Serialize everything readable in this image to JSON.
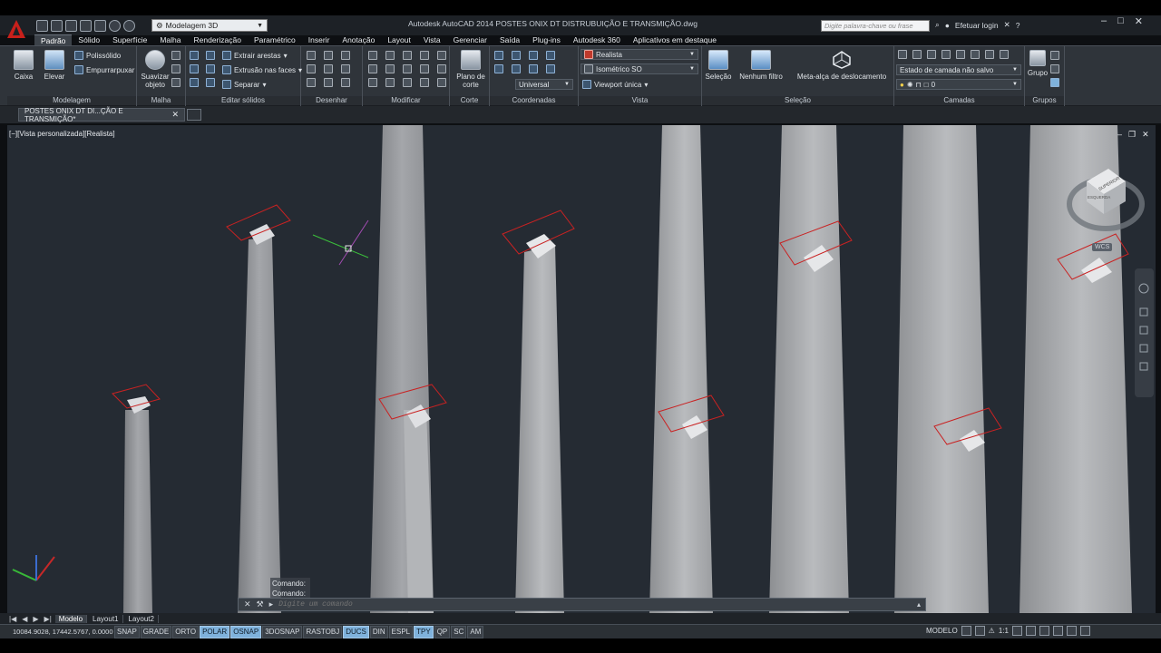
{
  "window": {
    "title": "Autodesk AutoCAD 2014     POSTES ONIX DT DISTRUBUIÇÃO E TRANSMIÇÃO.dwg",
    "workspace": "Modelagem 3D",
    "search_placeholder": "Digite palavra-chave ou frase",
    "login_label": "Efetuar login"
  },
  "ribbon": {
    "tabs": [
      "Padrão",
      "Sólido",
      "Superfície",
      "Malha",
      "Renderização",
      "Paramétrico",
      "Inserir",
      "Anotação",
      "Layout",
      "Vista",
      "Gerenciar",
      "Saída",
      "Plug-ins",
      "Autodesk 360",
      "Aplicativos em destaque"
    ],
    "active_tab": "Padrão",
    "modelagem": {
      "label": "Modelagem",
      "caixa": "Caixa",
      "elevar": "Elevar",
      "polissolido": "Polissólido",
      "empurrarpuxar": "Empurrarpuxar"
    },
    "malha": {
      "label": "Malha",
      "suavizar": "Suavizar objeto"
    },
    "editar_solidos": {
      "label": "Editar sólidos",
      "extrair": "Extrair arestas",
      "extrusao": "Extrusão nas faces",
      "separar": "Separar"
    },
    "desenhar": {
      "label": "Desenhar"
    },
    "modificar": {
      "label": "Modificar"
    },
    "corte": {
      "label": "Corte",
      "plano": "Plano de corte"
    },
    "coordenadas": {
      "label": "Coordenadas",
      "universal": "Universal"
    },
    "vista": {
      "label": "Vista",
      "style": "Realista",
      "view": "Isométrico SO",
      "viewport": "Viewport única"
    },
    "selecao": {
      "label": "Seleção",
      "selecao": "Seleção",
      "filtro": "Nenhum filtro",
      "meta": "Meta-alça de deslocamento"
    },
    "camadas": {
      "label": "Camadas",
      "estado": "Estado de camada não salvo",
      "layer": "0"
    },
    "grupos": {
      "label": "Grupos",
      "grupo": "Grupo"
    }
  },
  "document_tab": "POSTES ONIX DT DI...ÇÃO E TRANSMIÇÃO*",
  "viewport": {
    "label": "[−][Vista personalizada][Realista]",
    "viewcube_face": "SUPERIOR",
    "viewcube_side": "ESQUERDA",
    "wcs": "WCS"
  },
  "command": {
    "history": [
      "Comando:",
      "Comando:"
    ],
    "placeholder": "Digite um comando"
  },
  "layout_tabs": [
    "Modelo",
    "Layout1",
    "Layout2"
  ],
  "status": {
    "coords": "10084.9028, 17442.5767, 0.0000",
    "toggles": [
      {
        "label": "SNAP",
        "on": false
      },
      {
        "label": "GRADE",
        "on": false
      },
      {
        "label": "ORTO",
        "on": false
      },
      {
        "label": "POLAR",
        "on": true
      },
      {
        "label": "OSNAP",
        "on": true
      },
      {
        "label": "3DOSNAP",
        "on": false
      },
      {
        "label": "RASTOBJ",
        "on": false
      },
      {
        "label": "DUCS",
        "on": true
      },
      {
        "label": "DIN",
        "on": false
      },
      {
        "label": "ESPL",
        "on": false
      },
      {
        "label": "TPY",
        "on": true
      },
      {
        "label": "QP",
        "on": false
      },
      {
        "label": "SC",
        "on": false
      },
      {
        "label": "AM",
        "on": false
      }
    ],
    "model": "MODELO",
    "scale": "1:1"
  }
}
